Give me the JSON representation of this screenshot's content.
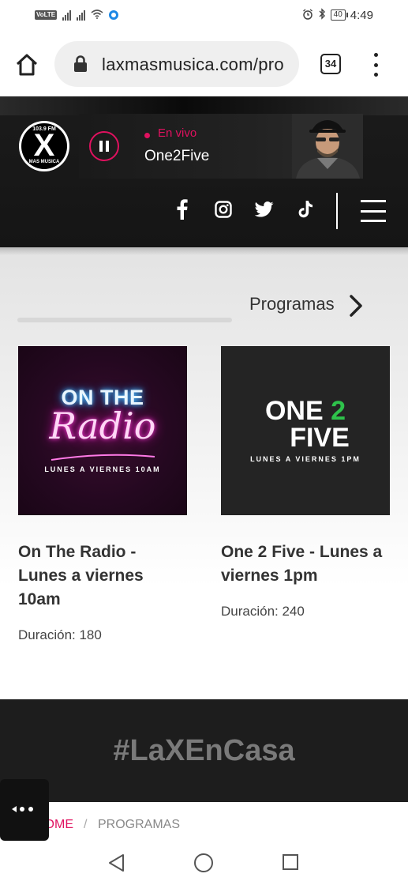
{
  "status_bar": {
    "volte": "VoLTE",
    "battery": "40",
    "time": "4:49"
  },
  "browser": {
    "url": "laxmasmusica.com/pro",
    "tab_count": "34"
  },
  "header": {
    "logo": {
      "frequency": "103.9 FM",
      "letter": "X",
      "tagline": "MAS MUSICA"
    },
    "player": {
      "status": "En vivo",
      "show": "One2Five",
      "accent_color": "#e0115f"
    },
    "social_icons": [
      "facebook-icon",
      "instagram-icon",
      "twitter-icon",
      "tiktok-icon"
    ],
    "menu_icon": "hamburger-icon"
  },
  "main": {
    "section_title": "Programas",
    "cards": [
      {
        "image": {
          "line1": "ON THE",
          "line2": "Radio",
          "line3": "LUNES A VIERNES 10AM"
        },
        "title": "On The Radio - Lunes a viernes 10am",
        "duration": "Duración: 180"
      },
      {
        "image": {
          "line1a": "ONE ",
          "line1b": "2",
          "line2": "FIVE",
          "line3": "LUNES A VIERNES 1PM"
        },
        "title": "One 2 Five - Lunes a viernes 1pm",
        "duration": "Duración: 240"
      }
    ]
  },
  "banner": {
    "text": "#LaXEnCasa"
  },
  "breadcrumb": {
    "home": "HOME",
    "separator": "/",
    "current": "PROGRAMAS"
  },
  "nav_bar": {
    "icons": [
      "back-icon",
      "home-icon",
      "recents-icon"
    ]
  }
}
